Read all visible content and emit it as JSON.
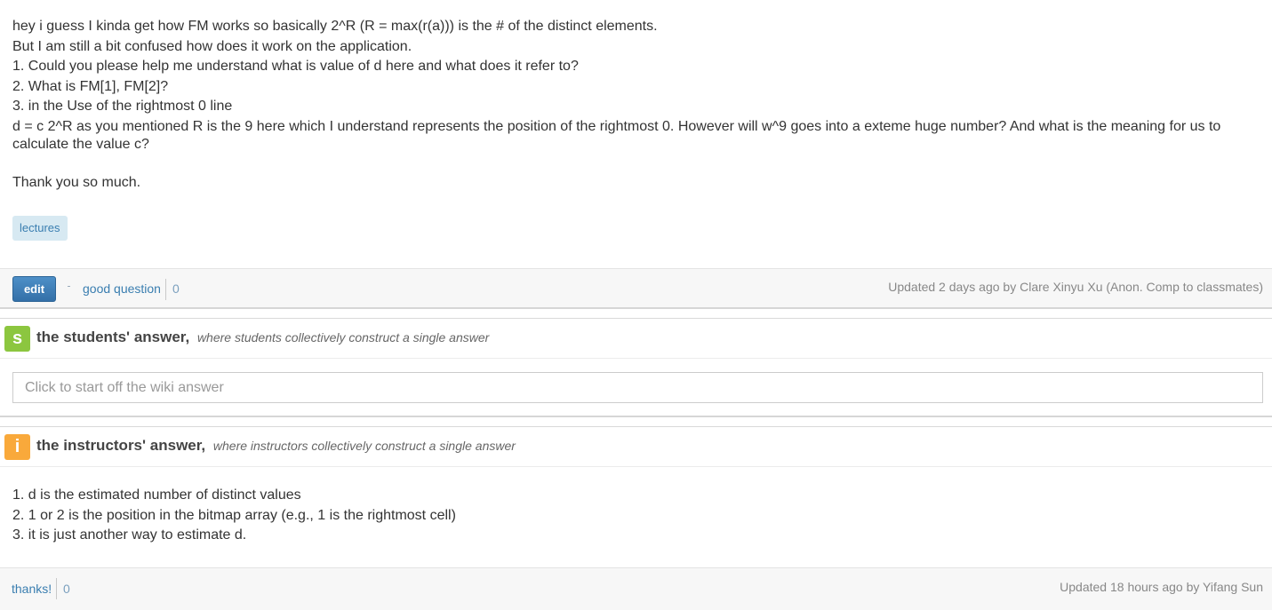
{
  "question": {
    "lines": [
      "hey i guess I kinda get how FM works so basically 2^R (R = max(r(a)))  is the # of the distinct elements.",
      "But I am still a bit confused how does it work on the application.",
      "1. Could you please help me understand what is value of d here and what does it refer to?",
      "2. What is FM[1], FM[2]?",
      "3. in the Use of the rightmost 0 line",
      "d = c 2^R as you mentioned R is the 9 here which I understand represents the position of the rightmost 0. However will w^9 goes into a exteme huge number? And what is the meaning for us to",
      "calculate the value c?",
      "Thank you so much."
    ],
    "tag": "lectures",
    "footer": {
      "edit_label": "edit",
      "good_question_label": "good question",
      "good_question_count": "0",
      "updated": "Updated 2 days ago by Clare Xinyu Xu (Anon. Comp to classmates)"
    }
  },
  "students_answer": {
    "badge": "s",
    "title": "the students' answer,",
    "subtitle": "where students collectively construct a single answer",
    "placeholder": "Click to start off the wiki answer"
  },
  "instructors_answer": {
    "badge": "i",
    "title": "the instructors' answer,",
    "subtitle": "where instructors collectively construct a single answer",
    "lines": [
      "1. d is the estimated number of distinct values",
      "2. 1 or 2 is the position in the bitmap array (e.g., 1 is the rightmost cell)",
      "3. it is just another way to estimate d."
    ],
    "footer": {
      "thanks_label": "thanks!",
      "thanks_count": "0",
      "updated": "Updated 18 hours ago by Yifang Sun"
    }
  },
  "colors": {
    "link": "#3a7eb0",
    "edit_button": "#3b7bb5",
    "student_badge": "#8cc63f",
    "instructor_badge": "#f9a93b",
    "tag_background": "#d7e9f2"
  }
}
